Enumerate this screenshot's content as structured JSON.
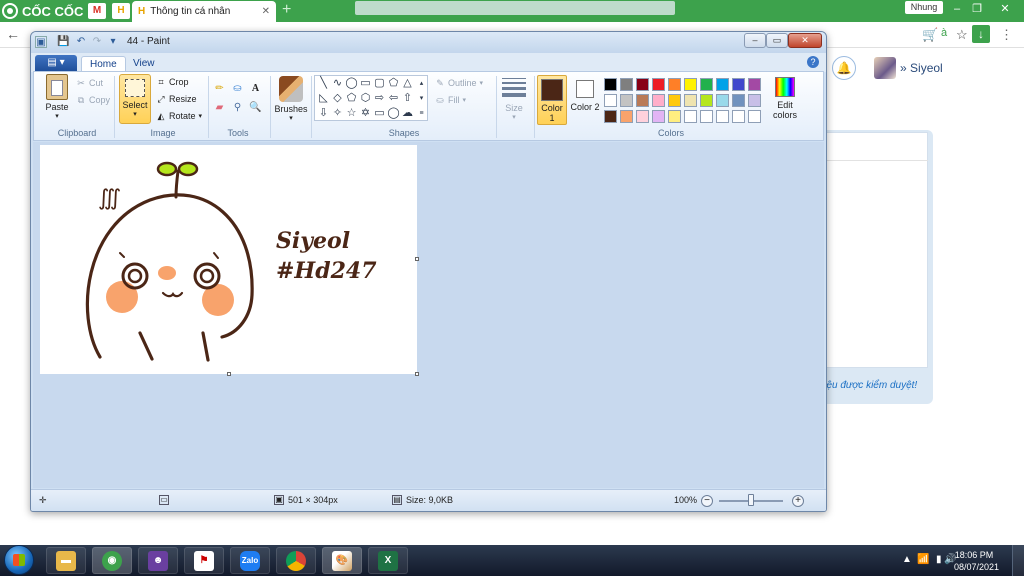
{
  "browser": {
    "brand": "CỐC CỐC",
    "tab_title": "Thông tin cá nhân",
    "tab_close": "✕",
    "new_tab": "+",
    "profile_name": "Nhung",
    "icons": [
      "coccoc-logo-icon",
      "gmail-icon",
      "hd-icon",
      "download-icon",
      "star-icon",
      "back-arrow-icon"
    ]
  },
  "webpage": {
    "username": "Siyeol",
    "user_menu_caret": "»",
    "review_note": "liệu được kiểm duyệt!"
  },
  "paint": {
    "window_title": "44 - Paint",
    "menu_button": "▤ ▾",
    "tabs": [
      "Home",
      "View"
    ],
    "active_tab": "Home",
    "clipboard": {
      "paste": "Paste",
      "cut": "Cut",
      "copy": "Copy",
      "group": "Clipboard"
    },
    "image": {
      "select": "Select",
      "crop": "Crop",
      "resize": "Resize",
      "rotate": "Rotate",
      "group": "Image"
    },
    "tools_group": "Tools",
    "brushes": "Brushes",
    "shapes": {
      "outline": "Outline",
      "fill": "Fill",
      "group": "Shapes"
    },
    "size": "Size",
    "colors": {
      "color1_label": "Color 1",
      "color2_label": "Color 2",
      "edit_colors": "Edit colors",
      "group": "Colors",
      "color1": "#4b2616",
      "color2": "#ffffff",
      "palette": [
        [
          "#000000",
          "#7f7f7f",
          "#880015",
          "#ed1c24",
          "#ff7f27",
          "#fff200",
          "#22b14c",
          "#00a2e8",
          "#3f48cc",
          "#a349a4"
        ],
        [
          "#ffffff",
          "#c3c3c3",
          "#b97a57",
          "#ffaec9",
          "#ffc90e",
          "#efe4b0",
          "#b5e61d",
          "#99d9ea",
          "#7092be",
          "#c8bfe7"
        ],
        [
          "#4b2616",
          "#f8a36c",
          "#ffd1dc",
          "#e2b4f4",
          "#ffee80",
          "#ffffff",
          "#ffffff",
          "#ffffff",
          "#ffffff",
          "#ffffff"
        ]
      ]
    },
    "drawing": {
      "text_line1": "Siyeol",
      "text_line2": "#Hd247",
      "squiggle": "∭"
    },
    "status": {
      "dimensions": "501 × 304px",
      "file_size": "Size: 9,0KB",
      "zoom": "100%"
    }
  },
  "taskbar": {
    "apps": [
      "file-explorer",
      "coccoc-browser",
      "game",
      "app-red",
      "zalo",
      "chrome",
      "paint",
      "excel"
    ],
    "zalo_label": "Zalo",
    "time": "18:06 PM",
    "date": "08/07/2021"
  }
}
